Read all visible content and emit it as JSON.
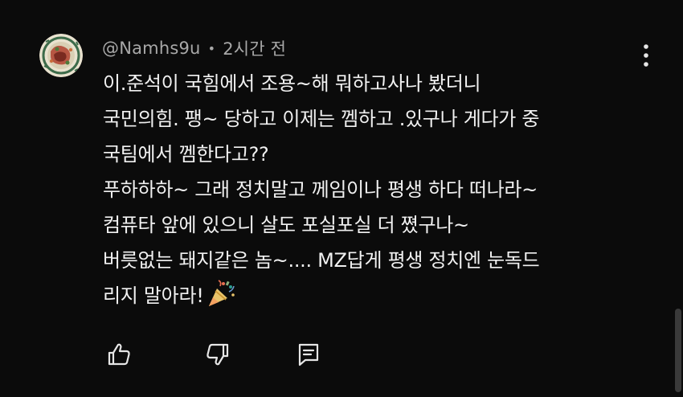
{
  "comment": {
    "author": "@Namhs9u",
    "separator": "•",
    "time": "2시간 전",
    "lines": [
      "이.준석이 국힘에서 조용~해 뭐하고사나 봤더니",
      "국민의힘. 팽~ 당하고 이제는 껨하고 .있구나 게다가 중",
      "국팀에서 껨한다고??",
      "푸하하하~ 그래 정치말고 께임이나 평생 하다 떠나라~",
      "컴퓨타 앞에 있으니 살도 포실포실 더 쪘구나~",
      "버릇없는 돼지같은 놈~.... MZ답게 평생 정치엔 눈독드",
      "리지 말아라!"
    ],
    "emoji": "party-popper-icon"
  },
  "actions": {
    "like": "thumbs-up-icon",
    "dislike": "thumbs-down-icon",
    "reply": "reply-icon"
  },
  "colors": {
    "background": "#0b0b0b",
    "text": "#f1f1f1",
    "meta": "#a8a8a8",
    "icon": "#e6e6e6"
  }
}
